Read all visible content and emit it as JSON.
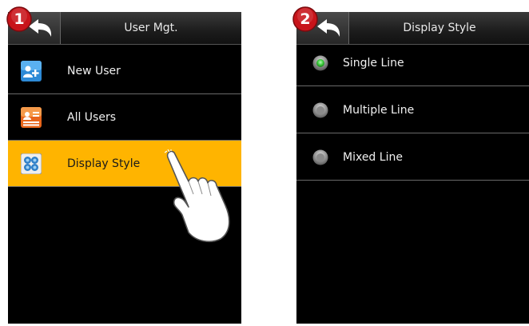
{
  "screen1": {
    "title": "User Mgt.",
    "step_number": "1",
    "items": [
      {
        "label": "New User",
        "icon": "add-user-icon"
      },
      {
        "label": "All Users",
        "icon": "user-list-icon"
      },
      {
        "label": "Display Style",
        "icon": "display-style-icon",
        "selected": true
      }
    ],
    "highlight_color": "#ffb400"
  },
  "screen2": {
    "title": "Display Style",
    "step_number": "2",
    "options": [
      {
        "label": "Single Line",
        "selected": true
      },
      {
        "label": "Multiple Line",
        "selected": false
      },
      {
        "label": "Mixed Line",
        "selected": false
      }
    ]
  },
  "colors": {
    "badge": "#c8141a",
    "radio_selected": "#3ccc3c",
    "radio_unselected": "#8a8a8a"
  }
}
